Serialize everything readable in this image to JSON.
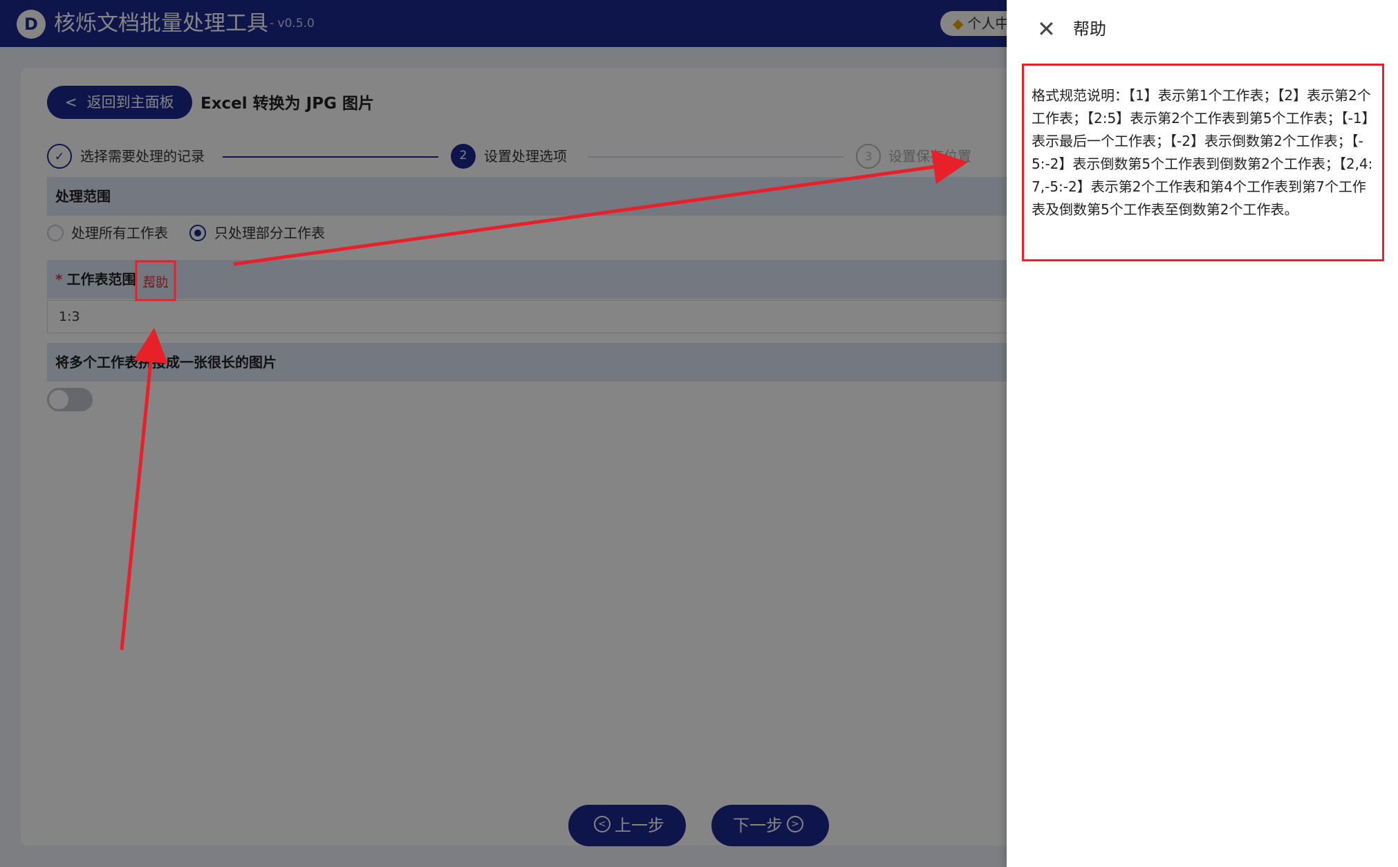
{
  "app": {
    "logo_letter": "D",
    "title": "核烁文档批量处理工具",
    "version": "- v0.5.0",
    "user_pill": "个人中"
  },
  "header": {
    "back_label": "返回到主面板",
    "page_heading": "Excel 转换为 JPG 图片"
  },
  "steps": [
    {
      "number": "✓",
      "label": "选择需要处理的记录"
    },
    {
      "number": "2",
      "label": "设置处理选项"
    },
    {
      "number": "3",
      "label": "设置保存位置"
    }
  ],
  "range_section": {
    "title": "处理范围",
    "option_all": "处理所有工作表",
    "option_partial": "只处理部分工作表",
    "selected": "只处理部分工作表"
  },
  "sheet_range": {
    "required": "*",
    "label": "工作表范围",
    "help_link": "帮助",
    "value": "1:3"
  },
  "merge_section": {
    "title": "将多个工作表拼接成一张很长的图片",
    "toggle_on": false
  },
  "footer": {
    "prev_label": "上一步",
    "next_label": "下一步"
  },
  "drawer": {
    "title": "帮助",
    "help_text": "格式规范说明：【1】表示第1个工作表；【2】表示第2个工作表；【2:5】表示第2个工作表到第5个工作表；【-1】表示最后一个工作表；【-2】表示倒数第2个工作表；【-5:-2】表示倒数第5个工作表到倒数第2个工作表；【2,4:7,-5:-2】表示第2个工作表和第4个工作表到第7个工作表及倒数第5个工作表至倒数第2个工作表。"
  },
  "colors": {
    "primary": "#1c2a8f",
    "annotation_red": "#e8202a",
    "mask": "rgba(0,0,0,0.48)"
  },
  "icons": {
    "close": "close-icon",
    "back": "chevron-left-icon",
    "check": "check-icon",
    "gem": "gem-icon"
  }
}
